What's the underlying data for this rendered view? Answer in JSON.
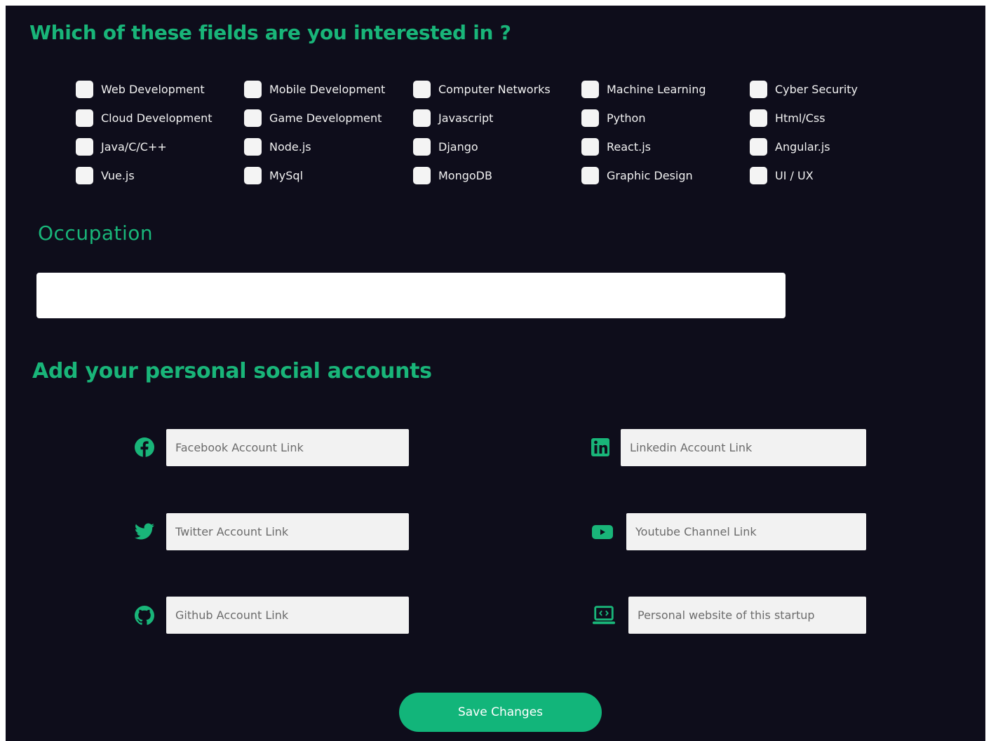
{
  "interests": {
    "title": "Which of these fields are you interested in ?",
    "options": [
      "Web Development",
      "Mobile Development",
      "Computer Networks",
      "Machine Learning",
      "Cyber Security",
      "Cloud Development",
      "Game Development",
      "Javascript",
      "Python",
      "Html/Css",
      "Java/C/C++",
      "Node.js",
      "Django",
      "React.js",
      "Angular.js",
      "Vue.js",
      "MySql",
      "MongoDB",
      "Graphic Design",
      "UI / UX"
    ],
    "checked": [
      false,
      false,
      false,
      false,
      false,
      false,
      false,
      false,
      false,
      false,
      false,
      false,
      false,
      false,
      false,
      false,
      false,
      false,
      false,
      false
    ]
  },
  "occupation": {
    "title": "Occupation",
    "value": ""
  },
  "social": {
    "title": "Add your personal social accounts",
    "facebook_placeholder": "Facebook Account Link",
    "linkedin_placeholder": "Linkedin Account Link",
    "twitter_placeholder": "Twitter Account Link",
    "youtube_placeholder": "Youtube Channel Link",
    "github_placeholder": "Github Account Link",
    "website_placeholder": "Personal website of this startup",
    "icons": [
      "facebook-icon",
      "linkedin-icon",
      "twitter-icon",
      "youtube-icon",
      "github-icon",
      "laptop-code-icon"
    ]
  },
  "save_button": {
    "label": "Save Changes"
  },
  "colors": {
    "background": "#0e0d1b",
    "accent": "#19b579",
    "button": "#12b57a",
    "input_bg": "#f2f2f2"
  }
}
